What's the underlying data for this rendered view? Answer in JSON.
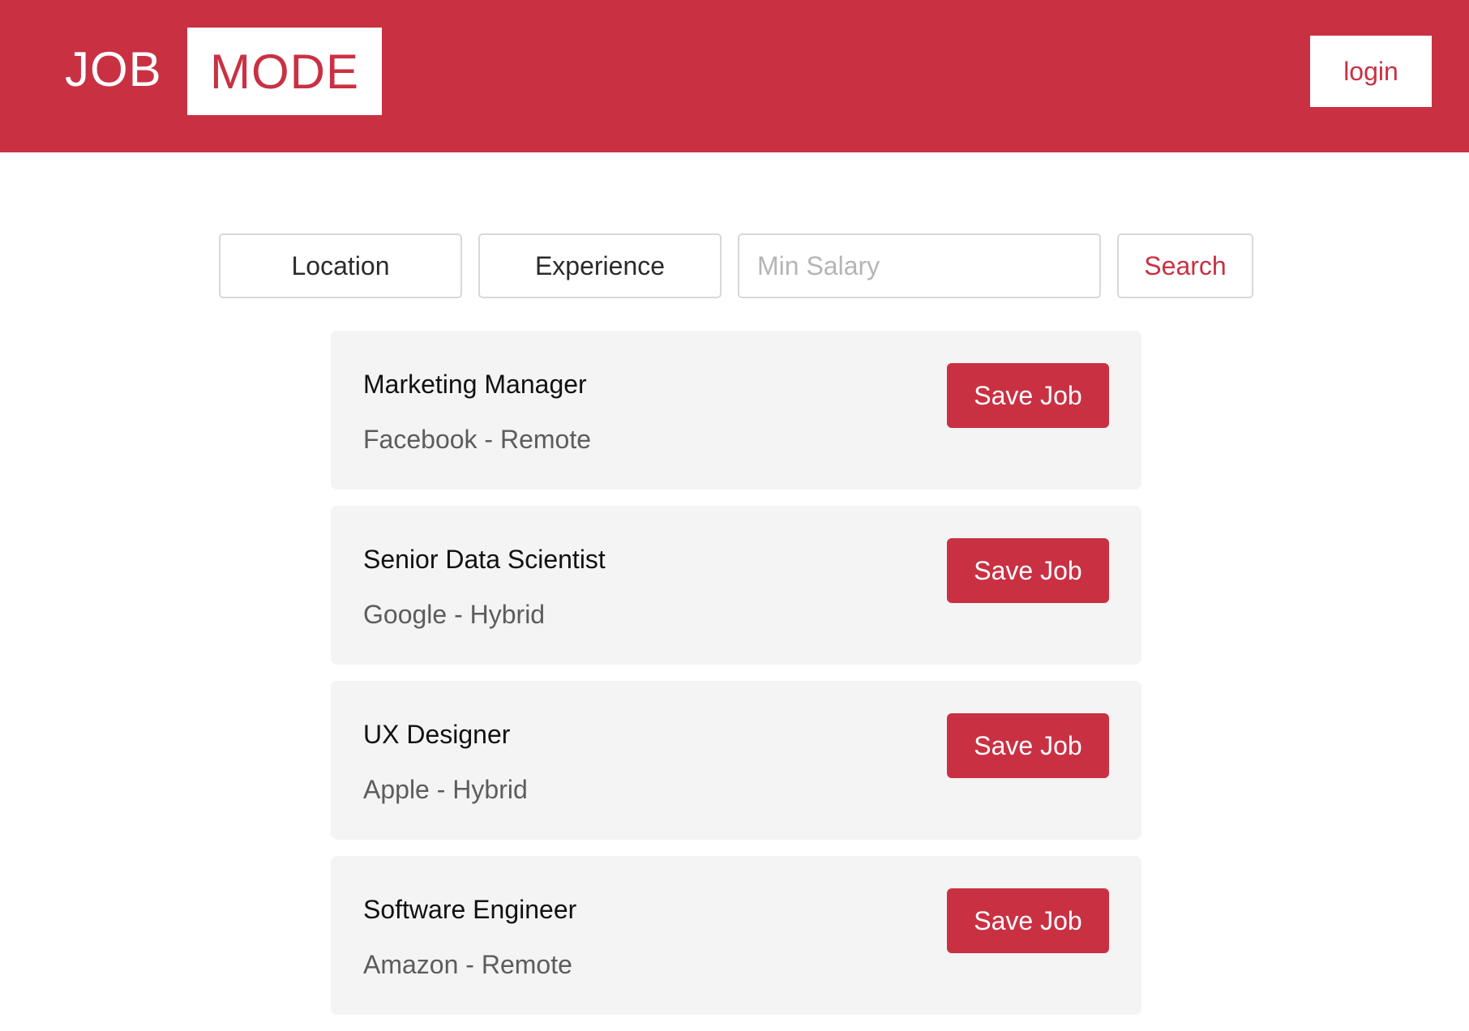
{
  "header": {
    "logo_part1": "JOB",
    "logo_part2": "MODE",
    "login_label": "login",
    "brand_color": "#c93143"
  },
  "search": {
    "location_label": "Location",
    "experience_label": "Experience",
    "salary_placeholder": "Min Salary",
    "salary_value": "",
    "search_label": "Search"
  },
  "jobs": [
    {
      "title": "Marketing Manager",
      "meta": "Facebook - Remote",
      "save_label": "Save Job"
    },
    {
      "title": "Senior Data Scientist",
      "meta": "Google - Hybrid",
      "save_label": "Save Job"
    },
    {
      "title": "UX Designer",
      "meta": "Apple - Hybrid",
      "save_label": "Save Job"
    },
    {
      "title": "Software Engineer",
      "meta": "Amazon - Remote",
      "save_label": "Save Job"
    }
  ]
}
